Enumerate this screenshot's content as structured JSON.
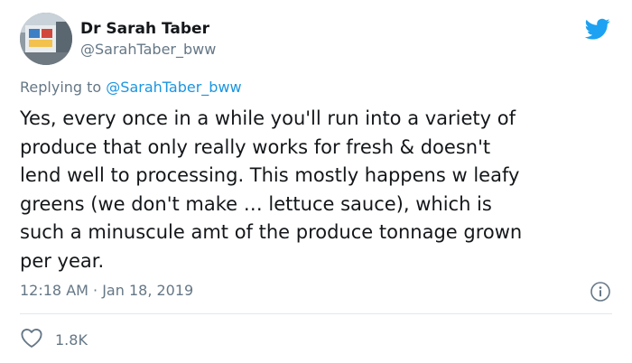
{
  "tweet": {
    "author_name": "Dr Sarah Taber",
    "author_handle": "@SarahTaber_bww",
    "reply_prefix": "Replying to",
    "reply_to": "@SarahTaber_bww",
    "body_lines": [
      "Yes, every once in a while you'll run into a variety of",
      "produce that only really works for fresh & doesn't",
      "lend well to processing. This mostly happens w leafy",
      "greens (we don't make … lettuce sauce), which is",
      "such a minuscule amt of the produce tonnage grown",
      "per year."
    ],
    "timestamp": "12:18 AM · Jan 18, 2019",
    "like_count": "1.8K"
  },
  "icons": {
    "brand": "twitter-bird-icon",
    "info": "info-icon",
    "like": "heart-icon"
  },
  "colors": {
    "brand": "#1da1f2",
    "link": "#1b95e0",
    "secondary_text": "#657786",
    "primary_text": "#14171a",
    "divider": "#e1e8ed"
  }
}
